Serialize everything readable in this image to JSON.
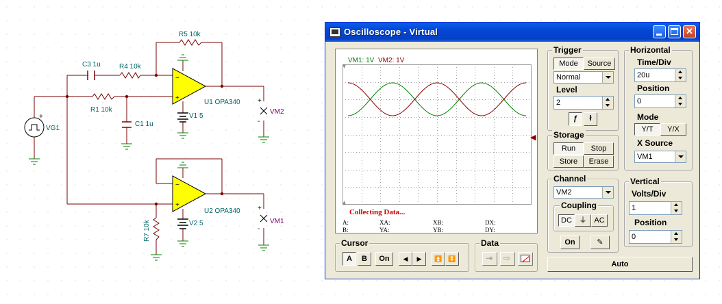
{
  "schematic": {
    "labels": {
      "r5": "R5 10k",
      "c3": "C3 1u",
      "r4": "R4 10k",
      "r1": "R1 10k",
      "c1": "C1 1u",
      "u1": "U1 OPA340",
      "v1": "V1 5",
      "vm2": "VM2",
      "vg1": "VG1",
      "u2": "U2 OPA340",
      "v2": "V2 5",
      "r7": "R7 10k",
      "vm1": "VM1"
    },
    "colors": {
      "wire": "#7a0000",
      "label": "#006464",
      "opamp": "#ffff00",
      "ground": "#008000"
    }
  },
  "window": {
    "title": "Oscilloscope - Virtual"
  },
  "display": {
    "legend_vm1": "VM1: 1V",
    "legend_vm2": "VM2: 1V",
    "status": "Collecting Data...",
    "readouts": {
      "a": "A:",
      "b": "B:",
      "xa": "XA:",
      "ya": "YA:",
      "xb": "XB:",
      "yb": "YB:",
      "dx": "DX:",
      "dy": "DY:"
    },
    "colors": {
      "vm1": "#008000",
      "vm2": "#8b0000",
      "grid": "#a0a0a0",
      "status": "#c00000"
    }
  },
  "trigger": {
    "title": "Trigger",
    "mode_label": "Mode",
    "source_label": "Source",
    "mode_value": "Normal",
    "level_label": "Level",
    "level_value": "2",
    "edge_rise_icon": "rising-edge-icon",
    "edge_fall_icon": "falling-edge-icon"
  },
  "storage": {
    "title": "Storage",
    "run": "Run",
    "stop": "Stop",
    "store": "Store",
    "erase": "Erase"
  },
  "horizontal": {
    "title": "Horizontal",
    "timediv_label": "Time/Div",
    "timediv_value": "20u",
    "position_label": "Position",
    "position_value": "0",
    "mode_label": "Mode",
    "yt": "Y/T",
    "yx": "Y/X",
    "xsource_label": "X Source",
    "xsource_value": "VM1"
  },
  "channel": {
    "title": "Channel",
    "value": "VM2",
    "coupling_label": "Coupling",
    "dc": "DC",
    "ac": "AC",
    "gnd_icon": "ground-icon",
    "on": "On",
    "probe_icon": "probe-icon"
  },
  "vertical": {
    "title": "Vertical",
    "voltsdiv_label": "Volts/Div",
    "voltsdiv_value": "1",
    "position_label": "Position",
    "position_value": "0"
  },
  "cursor": {
    "title": "Cursor",
    "a": "A",
    "b": "B",
    "on": "On"
  },
  "data": {
    "title": "Data"
  },
  "auto": "Auto"
}
